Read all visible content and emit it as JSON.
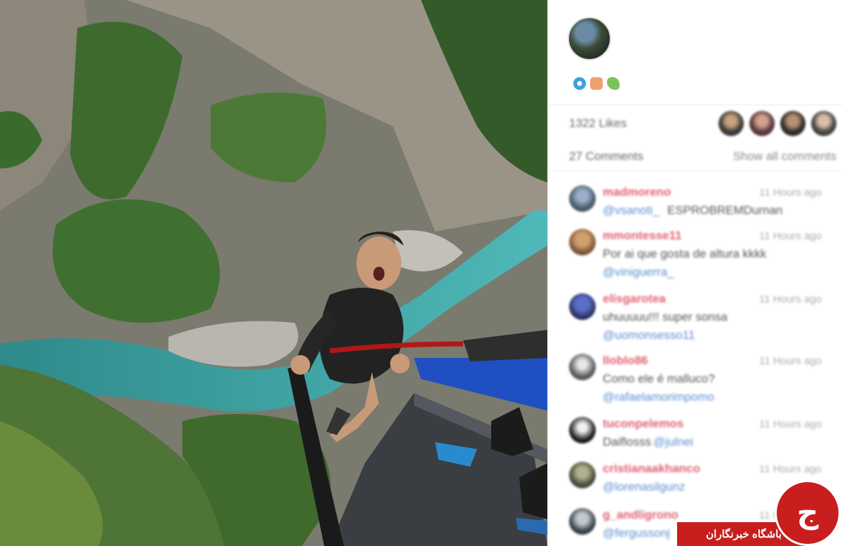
{
  "post": {
    "emoji_icons": [
      "swirl-emoji",
      "fist-emoji",
      "leaf-emoji"
    ],
    "likes_text": "1322 Likes",
    "comments_text": "27 Comments",
    "show_all_label": "Show all comments"
  },
  "comments": [
    {
      "user": "madmoreno",
      "time": "11 Hours ago",
      "mention": "@vsanoti_",
      "text": "ESPROBREMDurnan"
    },
    {
      "user": "mmontesse11",
      "time": "11 Hours ago",
      "text": "Por ai que gosta de altura kkkk",
      "mention": "@viniguerra_"
    },
    {
      "user": "elisgarotea",
      "time": "11 Hours ago",
      "text": "uhuuuuu!!! super sonsa",
      "mention": "@uomonsesso11"
    },
    {
      "user": "lloblo86",
      "time": "11 Hours ago",
      "text": "Como ele é malluco?",
      "mention": "@rafaelamorimpomo"
    },
    {
      "user": "tuconpelemos",
      "time": "11 Hours ago",
      "text": "Daiflosss",
      "mention": "@julnei"
    },
    {
      "user": "cristianaakhanco",
      "time": "11 Hours ago",
      "mention": "@lorenasilgunz"
    },
    {
      "user": "g_andligrono",
      "time": "11 Hours ago",
      "mention": "@fergussonj"
    }
  ],
  "watermark": {
    "text": "باشگاه خبرنگاران",
    "logo_glyph": "ج"
  },
  "colors": {
    "username": "#e06070",
    "mention": "#5a8fd0",
    "watermark": "#c81e1e"
  }
}
